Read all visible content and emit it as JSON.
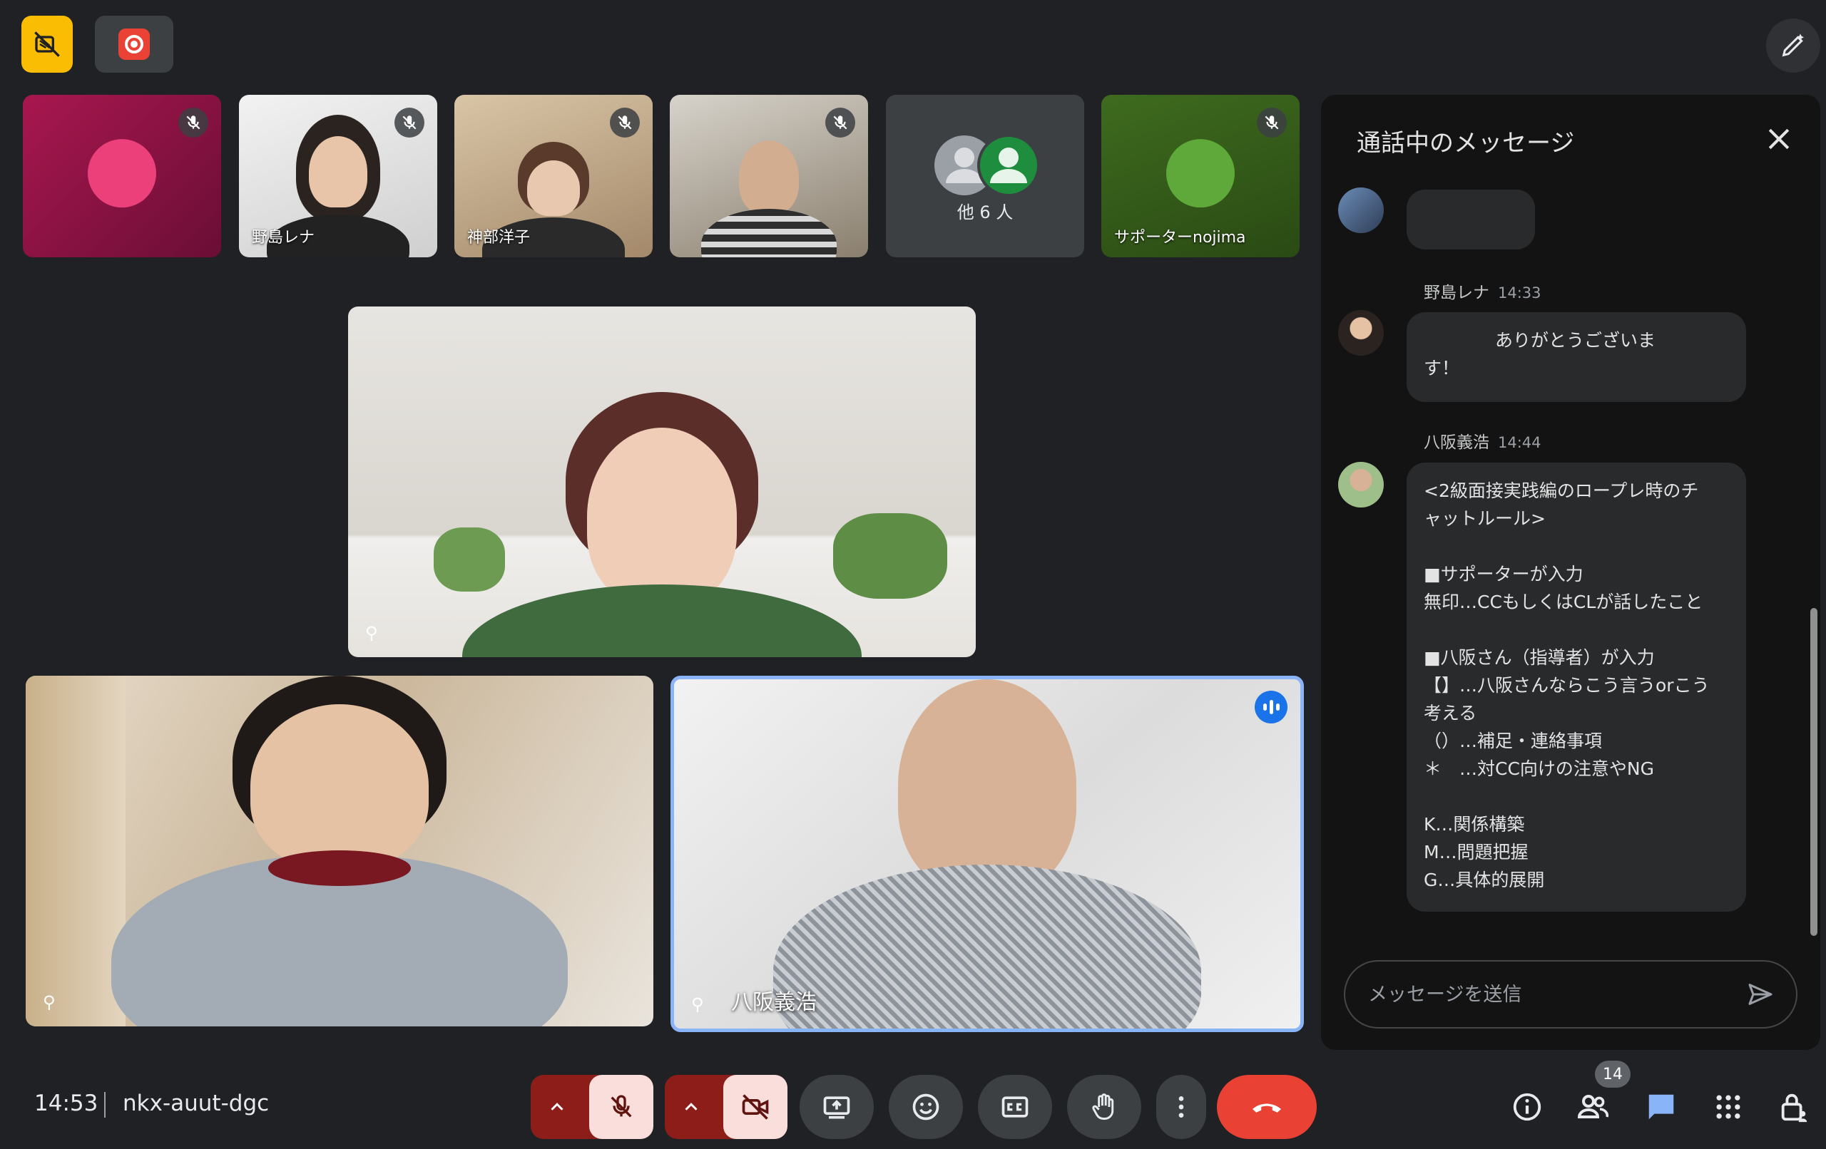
{
  "toolbar_top": {
    "noise_filter_icon": "no-video-icon",
    "recording_icon": "record-icon",
    "pencil_icon": "pencil-icon"
  },
  "thumbnails": [
    {
      "name": "",
      "muted": true,
      "kind": "avatar",
      "color": "#ec407a"
    },
    {
      "name": "野島レナ",
      "muted": true,
      "kind": "video"
    },
    {
      "name": "神部洋子",
      "muted": true,
      "kind": "video"
    },
    {
      "name": "",
      "muted": true,
      "kind": "video"
    },
    {
      "name": "他 6 人",
      "muted": false,
      "kind": "group"
    },
    {
      "name": "サポーターnojima",
      "muted": true,
      "kind": "avatar",
      "color": "#5ea93a"
    }
  ],
  "main_tiles": {
    "top_name": "",
    "bottom_left_name": "",
    "bottom_right_name": "八阪義浩"
  },
  "chat": {
    "title": "通話中のメッセージ",
    "messages": [
      {
        "sender": "",
        "time": "",
        "text": ""
      },
      {
        "sender": "野島レナ",
        "time": "14:33",
        "text": "　　　　ありがとうございま\nす！"
      },
      {
        "sender": "八阪義浩",
        "time": "14:44",
        "text": "<2級面接実践編のロープレ時のチ\nャットルール>\n\n■サポーターが入力\n無印…CCもしくはCLが話したこと\n\n■八阪さん（指導者）が入力\n【】…八阪さんならこう言うorこう\n考える\n（）…補足・連絡事項\n＊　…対CC向けの注意やNG\n\nK…関係構築\nM…問題把握\nG…具体的展開"
      }
    ],
    "input_placeholder": "メッセージを送信"
  },
  "bottom_bar": {
    "time": "14:53",
    "meeting_code": "nkx-auut-dgc",
    "people_count": "14"
  },
  "colors": {
    "background": "#202124",
    "accent_blue": "#8ab4f8",
    "leave_red": "#e94235",
    "alert_bg": "#8c1d18"
  }
}
